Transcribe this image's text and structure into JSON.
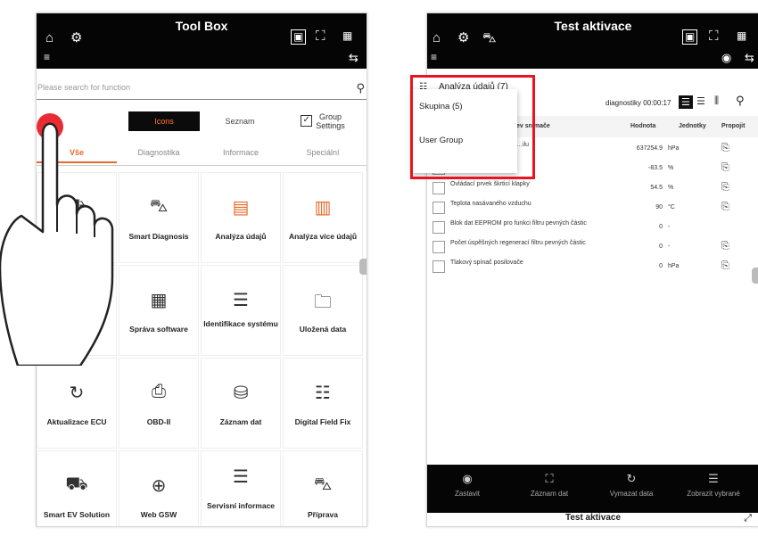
{
  "left_screen": {
    "title": "Tool Box",
    "search_placeholder": "Please search for function",
    "view_modes": {
      "icons": "Icons",
      "list": "Seznam",
      "group": "Group\nSettings"
    },
    "tabs": [
      "Vše",
      "Diagnostika",
      "Informace",
      "Speciální"
    ],
    "active_tab": "Vše",
    "tiles": [
      {
        "label": "",
        "icon": "car-search-icon"
      },
      {
        "label": "Smart Diagnosis",
        "icon": "car-diagnosis-icon"
      },
      {
        "label": "Analýza údajů",
        "icon": "data-analysis-icon"
      },
      {
        "label": "Analýza více údajů",
        "icon": "multi-data-analysis-icon"
      },
      {
        "label": "",
        "icon": "blank-icon"
      },
      {
        "label": "Správa software",
        "icon": "software-management-icon"
      },
      {
        "label": "Identifikace systému",
        "icon": "system-identification-icon"
      },
      {
        "label": "Uložená data",
        "icon": "saved-data-icon"
      },
      {
        "label": "Aktualizace ECU",
        "icon": "ecu-update-icon"
      },
      {
        "label": "OBD-II",
        "icon": "obd-icon"
      },
      {
        "label": "Záznam dat",
        "icon": "data-record-icon"
      },
      {
        "label": "Digital Field Fix",
        "icon": "digital-field-fix-icon"
      },
      {
        "label": "Smart EV Solution",
        "icon": "ev-solution-icon"
      },
      {
        "label": "Web GSW",
        "icon": "globe-icon"
      },
      {
        "label": "Servisní informace",
        "icon": "service-info-icon"
      },
      {
        "label": "Příprava",
        "icon": "preparation-icon"
      }
    ]
  },
  "right_screen": {
    "title": "Test aktivace",
    "filter_label": "Analýza údajů (7)",
    "timer_label": "diagnostiky 00:00:17",
    "columns": [
      "Název snímače",
      "Hodnota",
      "Jednotky",
      "Propojit"
    ],
    "column_partial": "ev snímače",
    "popup_items": [
      "Skupina (5)",
      "User Group"
    ],
    "rows": [
      {
        "name": "…ilu",
        "value": "637254.9",
        "unit": "hPa"
      },
      {
        "name": "",
        "value": "-83.5",
        "unit": "%"
      },
      {
        "name": "Ovládací prvek škrticí klapky",
        "value": "54.5",
        "unit": "%"
      },
      {
        "name": "Teplota nasávaného vzduchu",
        "value": "90",
        "unit": "°C"
      },
      {
        "name": "Blok dat EEPROM pro funkci filtru pevných částic",
        "value": "0",
        "unit": "-"
      },
      {
        "name": "Počet úspěšných regenerací filtru pevných částic",
        "value": "0",
        "unit": "-"
      },
      {
        "name": "Tlakový spínač posilovače",
        "value": "0",
        "unit": "hPa"
      }
    ],
    "bottom_actions": [
      {
        "label": "Zastavit",
        "icon": "stop-icon"
      },
      {
        "label": "Záznam dat",
        "icon": "record-icon"
      },
      {
        "label": "Vymazat data",
        "icon": "refresh-icon"
      },
      {
        "label": "Zobrazit vybrané",
        "icon": "show-selected-icon"
      }
    ],
    "footer_title": "Test aktivace"
  },
  "colors": {
    "accent": "#e76a2b",
    "highlight": "#e8141e",
    "bar": "#050505"
  }
}
